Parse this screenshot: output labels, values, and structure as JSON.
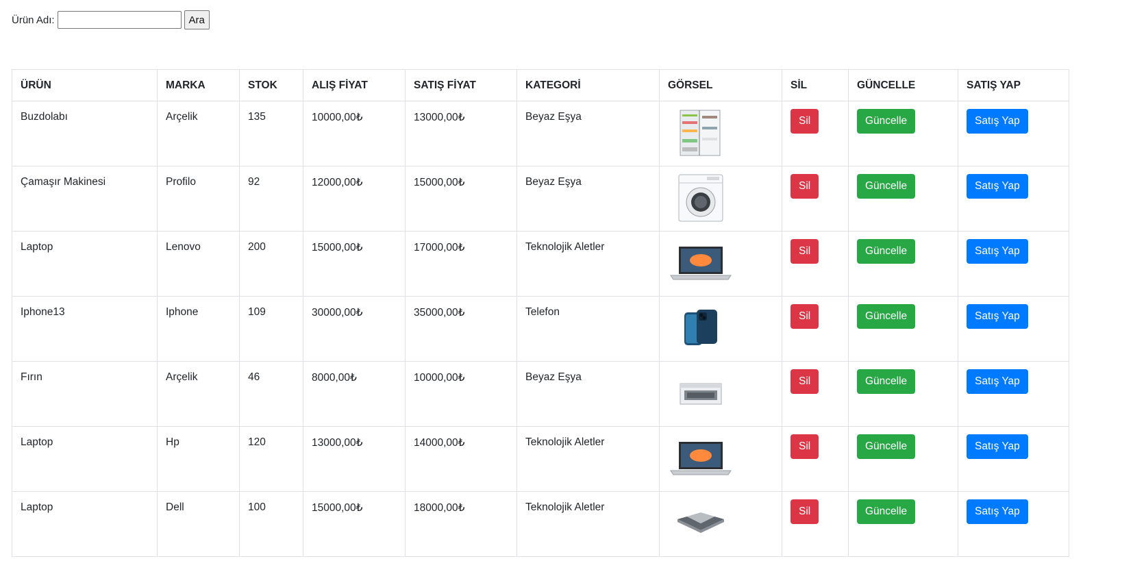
{
  "search": {
    "label": "Ürün Adı:",
    "value": "",
    "placeholder": "",
    "button": "Ara"
  },
  "table": {
    "headers": [
      "ÜRÜN",
      "MARKA",
      "STOK",
      "ALIŞ FİYAT",
      "SATIŞ FİYAT",
      "KATEGORİ",
      "GÖRSEL",
      "SİL",
      "GÜNCELLE",
      "SATIŞ YAP"
    ],
    "buttons": {
      "delete": "Sil",
      "update": "Güncelle",
      "sell": "Satış Yap"
    },
    "rows": [
      {
        "name": "Buzdolabı",
        "brand": "Arçelik",
        "stock": "135",
        "buy": "10000,00₺",
        "sell": "13000,00₺",
        "category": "Beyaz Eşya",
        "image": "refrigerator-image"
      },
      {
        "name": "Çamaşır Makinesi",
        "brand": "Profilo",
        "stock": "92",
        "buy": "12000,00₺",
        "sell": "15000,00₺",
        "category": "Beyaz Eşya",
        "image": "washing-machine-image"
      },
      {
        "name": "Laptop",
        "brand": "Lenovo",
        "stock": "200",
        "buy": "15000,00₺",
        "sell": "17000,00₺",
        "category": "Teknolojik Aletler",
        "image": "laptop-image"
      },
      {
        "name": "Iphone13",
        "brand": "Iphone",
        "stock": "109",
        "buy": "30000,00₺",
        "sell": "35000,00₺",
        "category": "Telefon",
        "image": "phone-image"
      },
      {
        "name": "Fırın",
        "brand": "Arçelik",
        "stock": "46",
        "buy": "8000,00₺",
        "sell": "10000,00₺",
        "category": "Beyaz Eşya",
        "image": "oven-image"
      },
      {
        "name": "Laptop",
        "brand": "Hp",
        "stock": "120",
        "buy": "13000,00₺",
        "sell": "14000,00₺",
        "category": "Teknolojik Aletler",
        "image": "laptop-image"
      },
      {
        "name": "Laptop",
        "brand": "Dell",
        "stock": "100",
        "buy": "15000,00₺",
        "sell": "18000,00₺",
        "category": "Teknolojik Aletler",
        "image": "convertible-laptop-image"
      }
    ]
  },
  "colors": {
    "delete": "#dc3545",
    "update": "#28a745",
    "sell": "#007bff",
    "border": "#dee2e6"
  }
}
